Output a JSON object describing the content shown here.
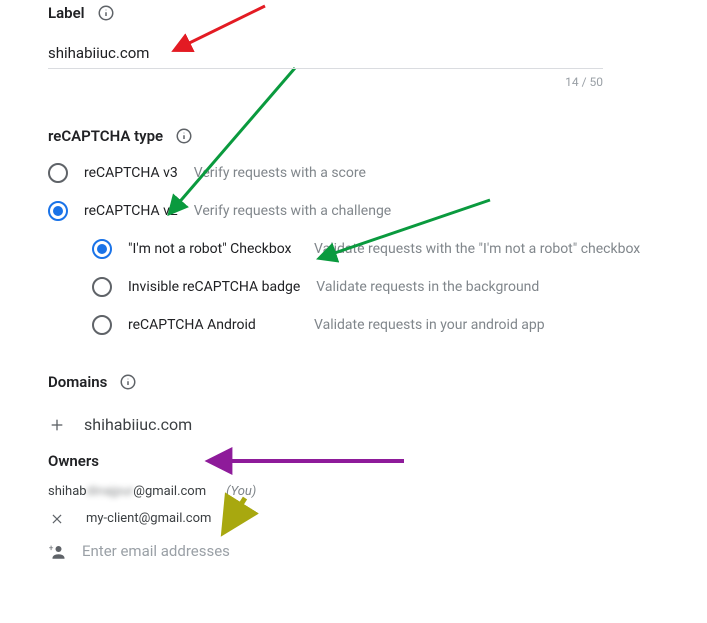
{
  "label": {
    "heading": "Label",
    "value": "shihabiiuc.com",
    "counter": "14 / 50"
  },
  "recaptcha": {
    "heading": "reCAPTCHA type",
    "options": [
      {
        "label": "reCAPTCHA v3",
        "desc": "Verify requests with a score",
        "checked": false
      },
      {
        "label": "reCAPTCHA v2",
        "desc": "Verify requests with a challenge",
        "checked": true
      }
    ],
    "v2_options": [
      {
        "label": "\"I'm not a robot\" Checkbox",
        "desc": "Validate requests with the \"I'm not a robot\" checkbox",
        "checked": true
      },
      {
        "label": "Invisible reCAPTCHA badge",
        "desc": "Validate requests in the background",
        "checked": false
      },
      {
        "label": "reCAPTCHA Android",
        "desc": "Validate requests in your android app",
        "checked": false
      }
    ]
  },
  "domains": {
    "heading": "Domains",
    "entries": [
      "shihabiiuc.com"
    ]
  },
  "owners": {
    "heading": "Owners",
    "primary_prefix": "shihab",
    "primary_blurred": "dinajpur",
    "primary_suffix": "@gmail.com",
    "you_label": "(You)",
    "others": [
      "my-client@gmail.com"
    ],
    "placeholder": "Enter email addresses"
  }
}
